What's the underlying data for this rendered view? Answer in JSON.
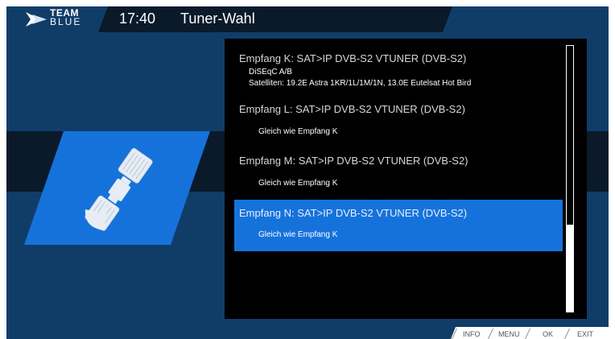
{
  "header": {
    "logo_line1": "TEAM",
    "logo_line2": "BLUE",
    "clock": "17:40",
    "title": "Tuner-Wahl"
  },
  "tuners": [
    {
      "title": "Empfang K: SAT>IP DVB-S2 VTUNER (DVB-S2)",
      "lines": [
        "DiSEqC A/B",
        "Satelliten: 19.2E Astra 1KR/1L/1M/1N, 13.0E Eutelsat Hot Bird"
      ],
      "selected": false
    },
    {
      "title": "Empfang L: SAT>IP DVB-S2 VTUNER (DVB-S2)",
      "lines": [
        "Gleich wie Empfang K"
      ],
      "selected": false
    },
    {
      "title": "Empfang M: SAT>IP DVB-S2 VTUNER (DVB-S2)",
      "lines": [
        "Gleich wie Empfang K"
      ],
      "selected": false
    },
    {
      "title": "Empfang N: SAT>IP DVB-S2 VTUNER (DVB-S2)",
      "lines": [
        "Gleich wie Empfang K"
      ],
      "selected": true
    }
  ],
  "buttons": {
    "info": "INFO",
    "menu": "MENU",
    "ok": "OK",
    "exit": "EXIT"
  },
  "icons": {
    "header_logo": "team-blue-logo-icon",
    "main": "satellite-icon"
  },
  "colors": {
    "background": "#103d68",
    "dark_band": "#0a1a2a",
    "accent": "#1672db",
    "panel": "#000000"
  }
}
